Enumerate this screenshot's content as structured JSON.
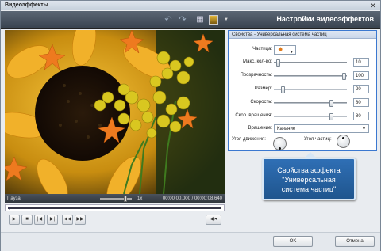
{
  "window": {
    "title": "Видеоэффекты"
  },
  "header": {
    "title": "Настройки видеоэффектов"
  },
  "player": {
    "status": "Пауза",
    "speed": "1x",
    "time": "00:00:00.000 / 00:00:08.640"
  },
  "properties": {
    "title": "Свойства - Универсальная система частиц",
    "particle_label": "Частица:",
    "sliders": [
      {
        "label": "Макс. кол-во:",
        "value": "10",
        "level": 0.05
      },
      {
        "label": "Прозрачность:",
        "value": "100",
        "level": 1.0
      },
      {
        "label": "Размер:",
        "value": "20",
        "level": 0.1
      },
      {
        "label": "Скорость:",
        "value": "80",
        "level": 0.8
      },
      {
        "label": "Скор. вращения:",
        "value": "80",
        "level": 0.8
      }
    ],
    "rotation_label": "Вращение:",
    "rotation_value": "Качание",
    "move_angle_label": "Угол движения:",
    "particle_angle_label": "Угол частиц:"
  },
  "callout": {
    "line1": "Свойства эффекта",
    "line2": "\"Универсальная",
    "line3": "система частиц\""
  },
  "footer": {
    "ok": "OK",
    "cancel": "Отмена"
  },
  "colors": {
    "accent": "#2f6fb5",
    "toolbar": "#3a4450",
    "particle": "#e07a1a"
  },
  "icons": [
    "close-icon",
    "undo-icon",
    "redo-icon",
    "grid-icon",
    "image-icon",
    "play-icon",
    "stop-icon",
    "prev-frame-icon",
    "next-frame-icon",
    "volume-icon",
    "star-particle-icon"
  ]
}
